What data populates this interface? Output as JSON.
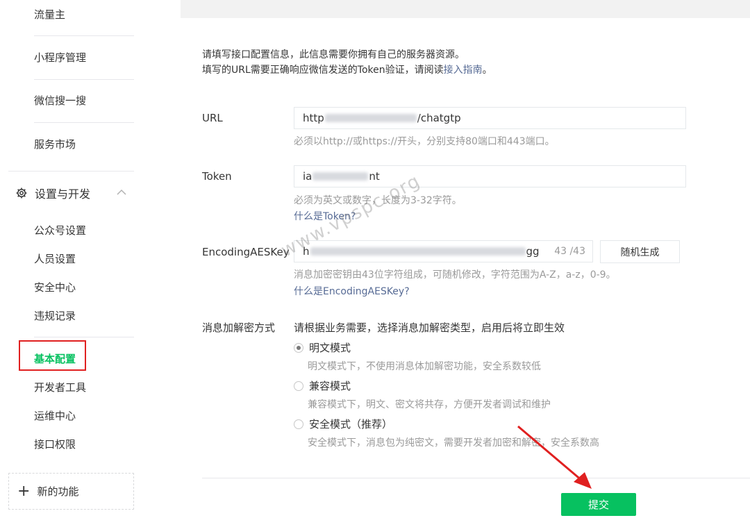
{
  "sidebar": {
    "top_items": [
      {
        "label": "流量主"
      },
      {
        "label": "小程序管理"
      },
      {
        "label": "微信搜一搜"
      },
      {
        "label": "服务市场"
      }
    ],
    "section": {
      "title": "设置与开发"
    },
    "sub_items": [
      {
        "label": "公众号设置"
      },
      {
        "label": "人员设置"
      },
      {
        "label": "安全中心"
      },
      {
        "label": "违规记录"
      },
      {
        "label": "基本配置"
      },
      {
        "label": "开发者工具"
      },
      {
        "label": "运维中心"
      },
      {
        "label": "接口权限"
      }
    ],
    "new_feature": "新的功能"
  },
  "intro": {
    "line1": "请填写接口配置信息，此信息需要你拥有自己的服务器资源。",
    "line2_prefix": "填写的URL需要正确响应微信发送的Token验证，请阅读",
    "line2_link": "接入指南",
    "line2_suffix": "。"
  },
  "form": {
    "url": {
      "label": "URL",
      "value_prefix": "http",
      "value_suffix": "/chatgtp",
      "hint": "必须以http://或https://开头，分别支持80端口和443端口。"
    },
    "token": {
      "label": "Token",
      "value_prefix": "ia",
      "value_suffix": "nt",
      "hint": "必须为英文或数字，长度为3-32字符。",
      "link": "什么是Token?"
    },
    "aes": {
      "label": "EncodingAESKey",
      "value_prefix": "h",
      "value_suffix": "gg",
      "counter": "43 /43",
      "random_button": "随机生成",
      "hint": "消息加密密钥由43位字符组成，可随机修改，字符范围为A-Z，a-z，0-9。",
      "link": "什么是EncodingAESKey?"
    },
    "encryption": {
      "label": "消息加解密方式",
      "intro": "请根据业务需要，选择消息加解密类型，启用后将立即生效",
      "options": [
        {
          "label": "明文模式",
          "desc": "明文模式下，不使用消息体加解密功能，安全系数较低",
          "checked": true
        },
        {
          "label": "兼容模式",
          "desc": "兼容模式下，明文、密文将共存，方便开发者调试和维护",
          "checked": false
        },
        {
          "label": "安全模式（推荐）",
          "desc": "安全模式下，消息包为纯密文，需要开发者加密和解密，安全系数高",
          "checked": false
        }
      ]
    }
  },
  "submit_label": "提交",
  "watermark": "www.vpspc.org",
  "colors": {
    "accent": "#07c160",
    "link": "#576b95",
    "annotation": "#e02020"
  }
}
